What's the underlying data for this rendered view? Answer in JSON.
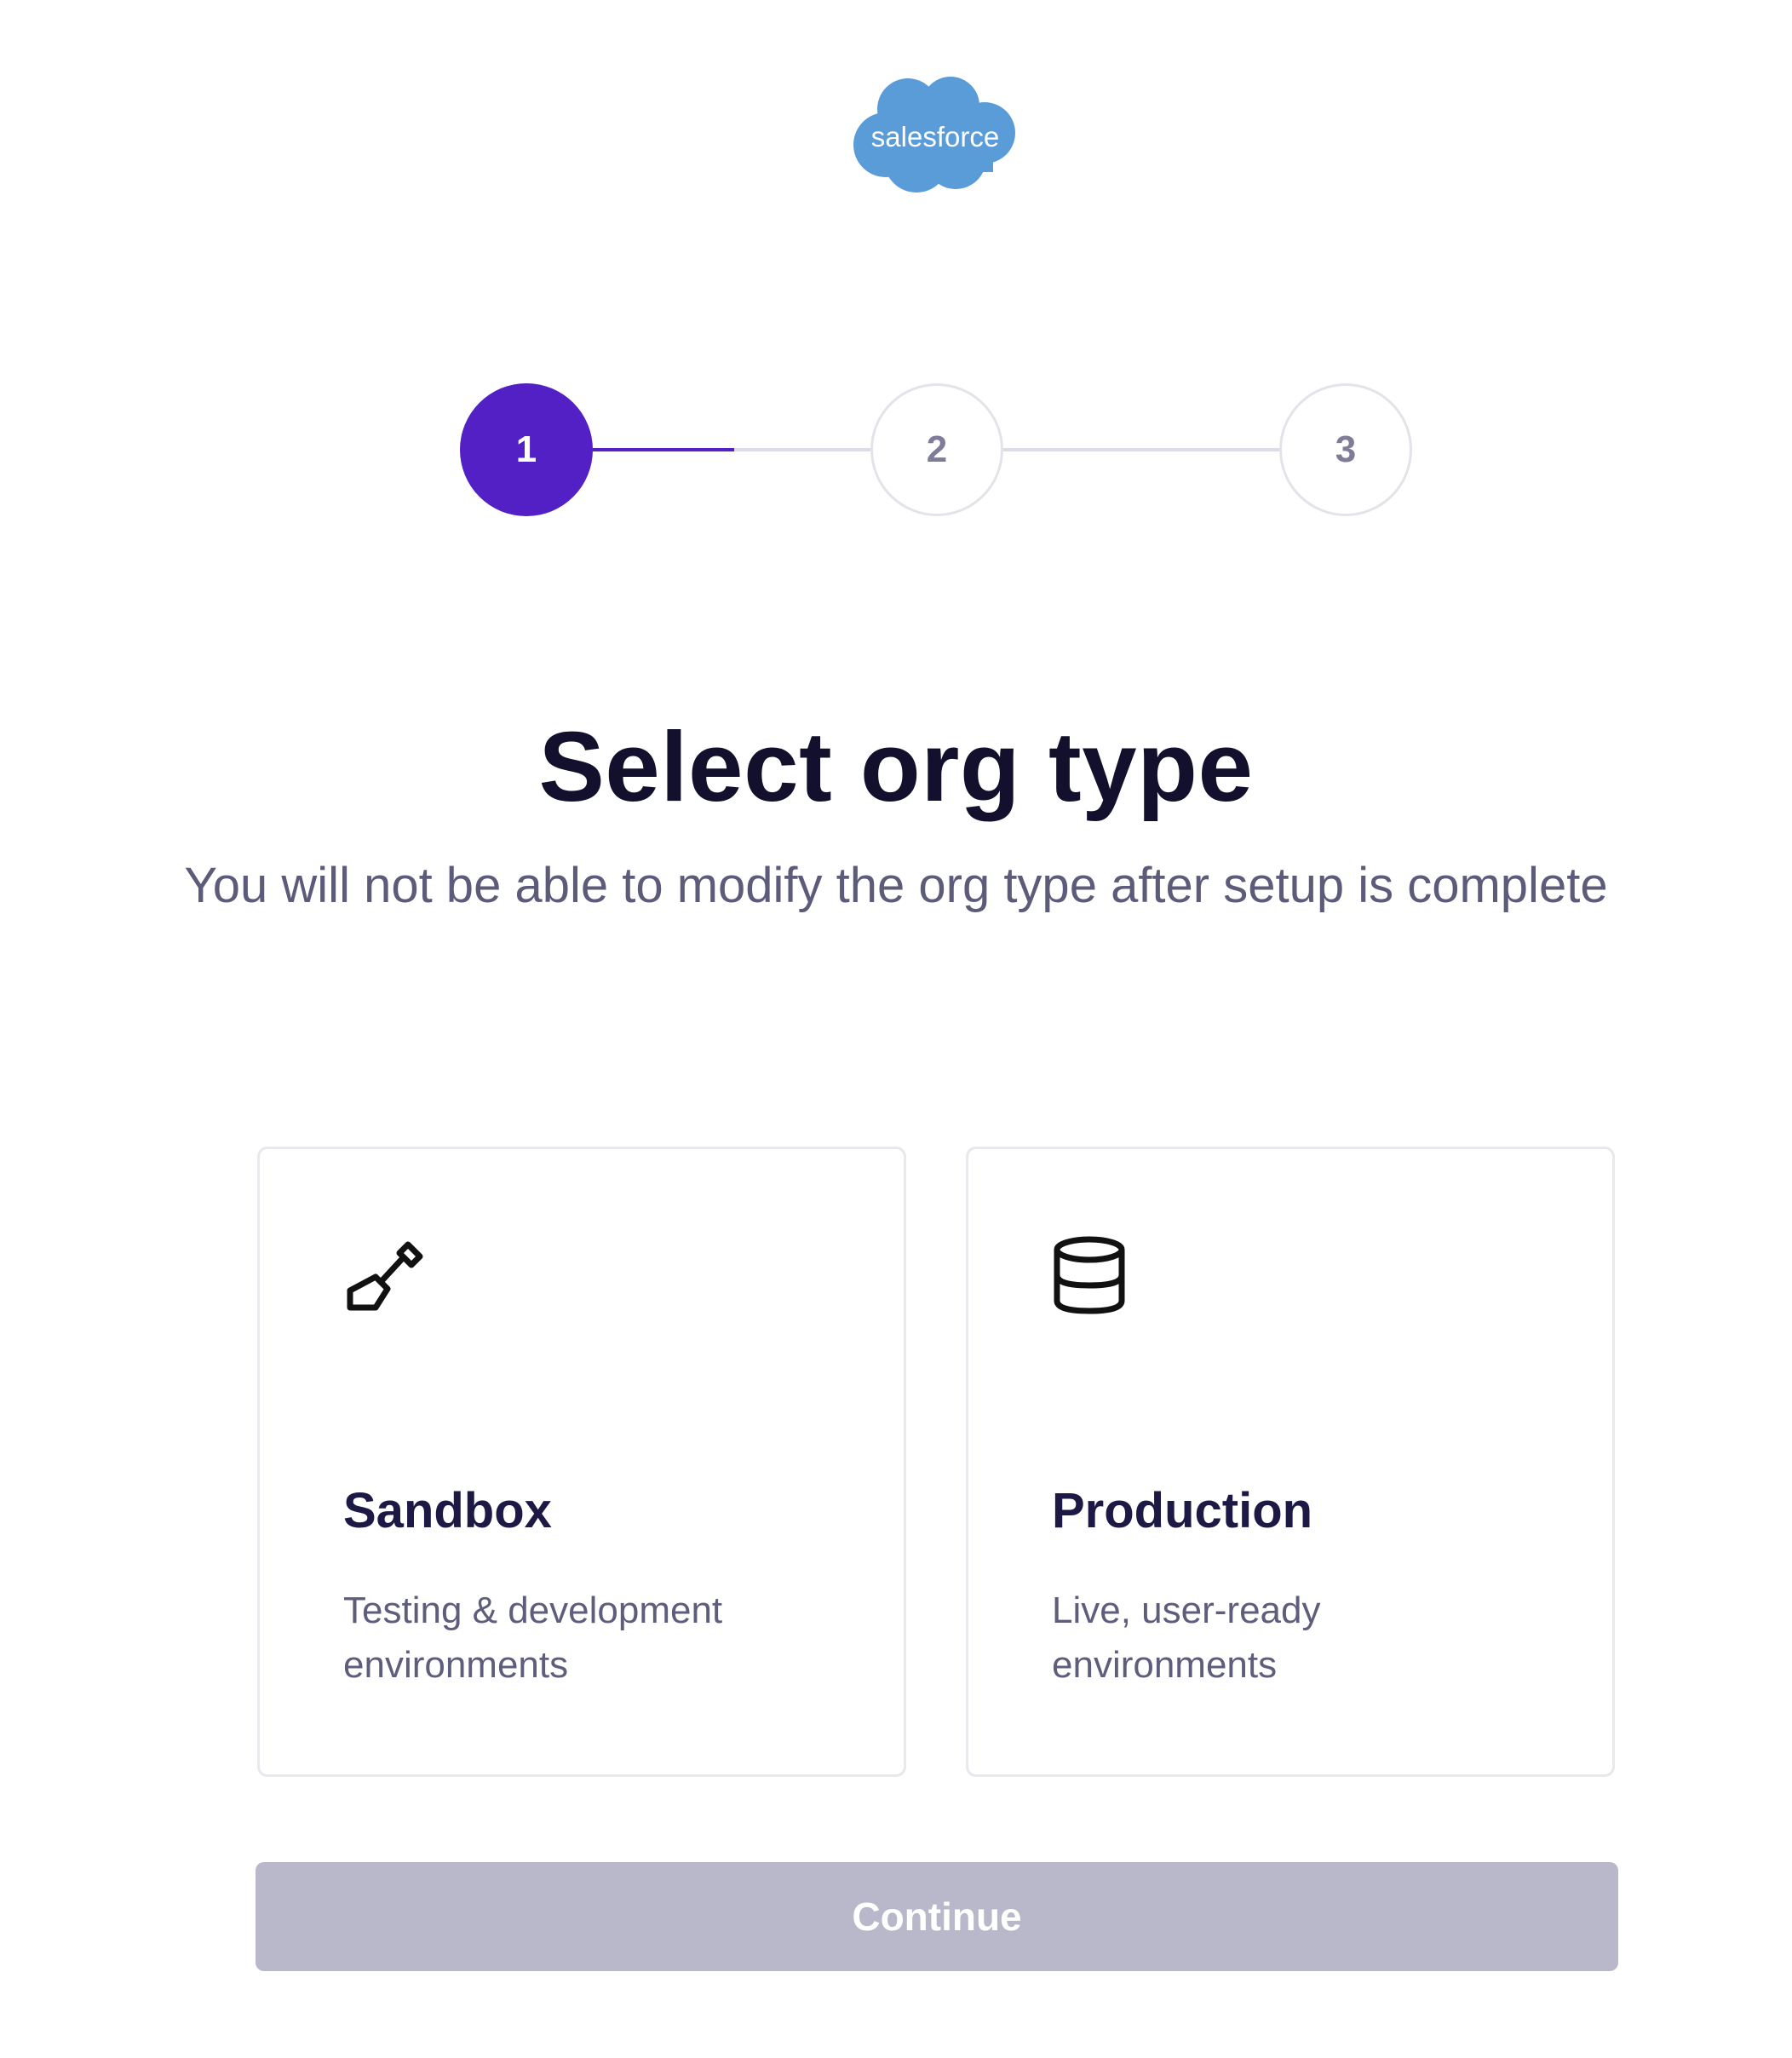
{
  "brand": {
    "logo_text": "salesforce",
    "logo_color": "#5a9cd8"
  },
  "stepper": {
    "steps": [
      {
        "label": "1",
        "state": "active"
      },
      {
        "label": "2",
        "state": "inactive"
      },
      {
        "label": "3",
        "state": "inactive"
      }
    ],
    "active_color": "#5220c4",
    "current_step": 1,
    "total_steps": 3
  },
  "header": {
    "title": "Select org type",
    "subtitle": "You will not be able to modify the org type after setup is complete"
  },
  "options": [
    {
      "id": "sandbox",
      "icon": "shovel-icon",
      "title": "Sandbox",
      "description": "Testing & development environments"
    },
    {
      "id": "production",
      "icon": "database-icon",
      "title": "Production",
      "description": "Live, user-ready environments"
    }
  ],
  "actions": {
    "continue_label": "Continue",
    "continue_enabled": false
  }
}
